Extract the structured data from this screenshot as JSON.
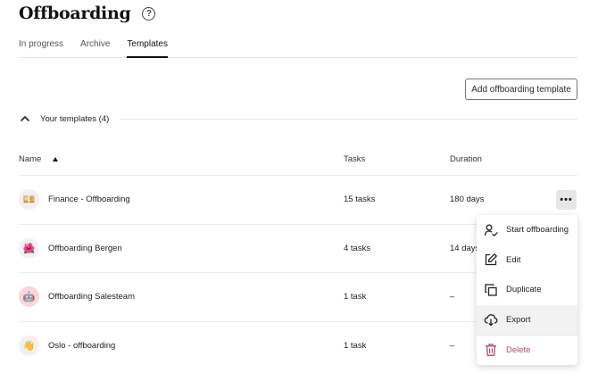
{
  "header": {
    "title": "Offboarding",
    "help_symbol": "?"
  },
  "tabs": [
    {
      "label": "In progress",
      "active": false
    },
    {
      "label": "Archive",
      "active": false
    },
    {
      "label": "Templates",
      "active": true
    }
  ],
  "actions": {
    "add_template": "Add offboarding template"
  },
  "section": {
    "label": "Your templates (4)"
  },
  "table": {
    "columns": {
      "name": "Name",
      "tasks": "Tasks",
      "duration": "Duration"
    },
    "rows": [
      {
        "emoji": "💴",
        "name": "Finance - Offboarding",
        "tasks": "15 tasks",
        "duration": "180 days"
      },
      {
        "emoji": "🌺",
        "name": "Offboarding Bergen",
        "tasks": "4 tasks",
        "duration": "14 days"
      },
      {
        "emoji": "🤖",
        "name": "Offboarding Salesteam",
        "tasks": "1 task",
        "duration": "–"
      },
      {
        "emoji": "👋",
        "name": "Oslo - offboarding",
        "tasks": "1 task",
        "duration": "–"
      }
    ]
  },
  "row_menu": {
    "more_symbol": "•••",
    "items": [
      {
        "label": "Start offboarding",
        "icon": "user-check-icon"
      },
      {
        "label": "Edit",
        "icon": "edit-icon"
      },
      {
        "label": "Duplicate",
        "icon": "duplicate-icon"
      },
      {
        "label": "Export",
        "icon": "cloud-download-icon"
      },
      {
        "label": "Delete",
        "icon": "trash-icon"
      }
    ]
  },
  "colors": {
    "accent_border": "#6b7fa0",
    "danger": "#b04b6a",
    "row_border": "#ececec"
  }
}
